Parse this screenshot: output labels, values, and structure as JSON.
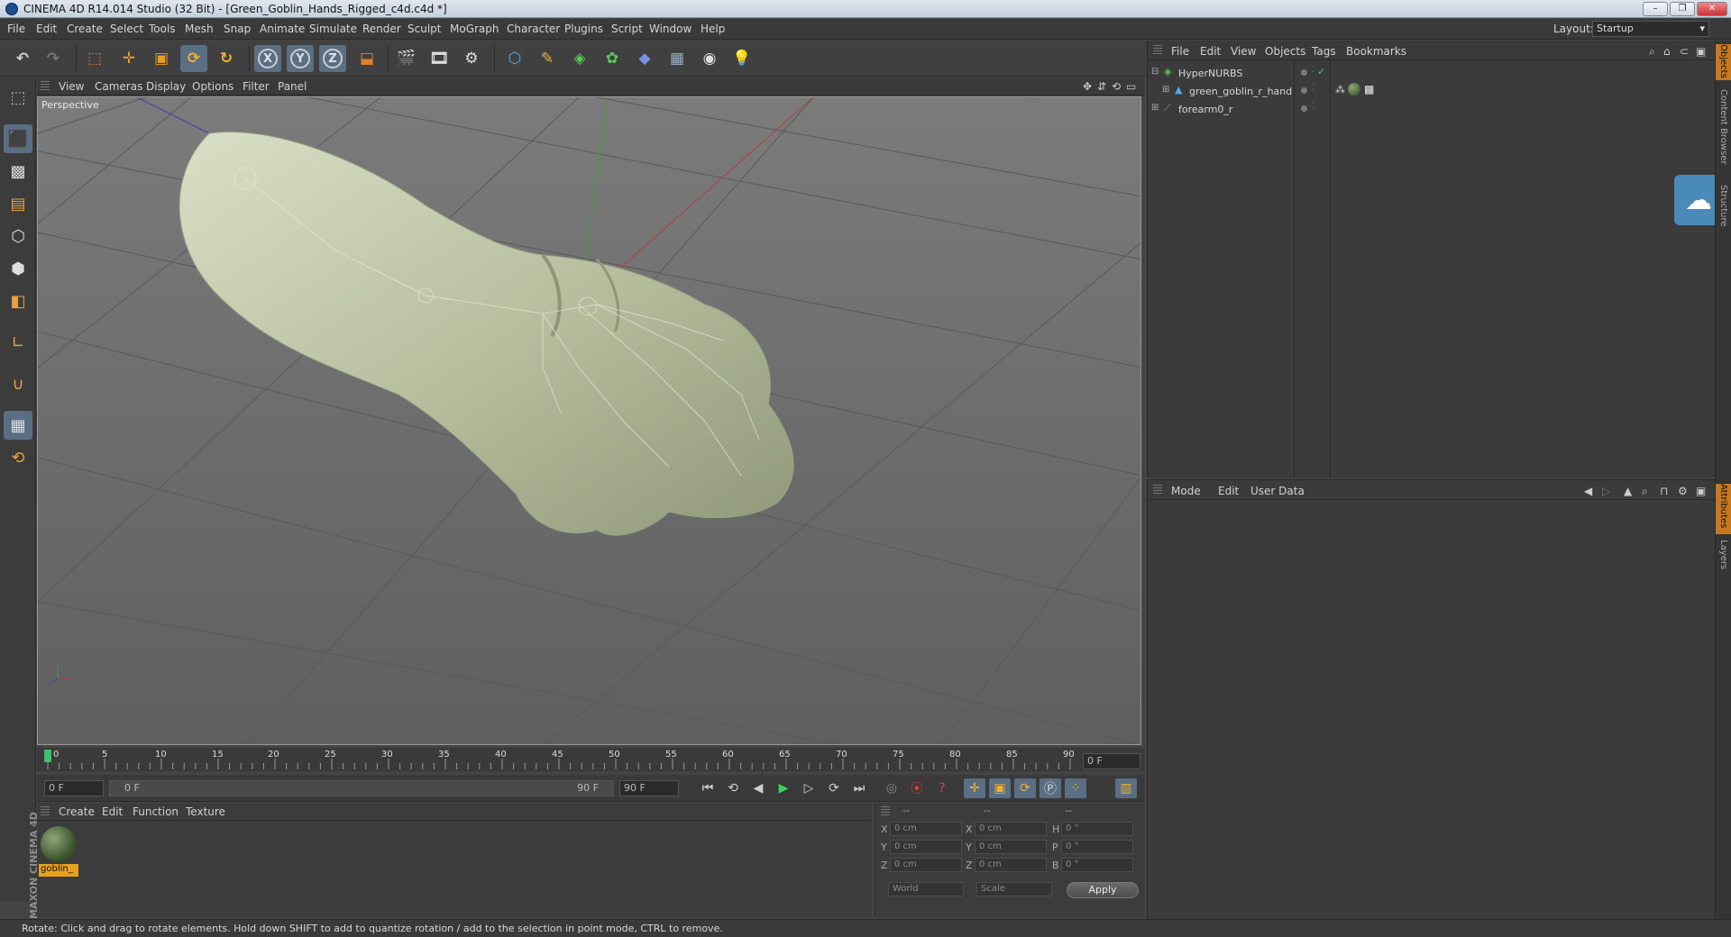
{
  "window": {
    "title": "CINEMA 4D R14.014 Studio (32 Bit) - [Green_Goblin_Hands_Rigged_c4d.c4d *]"
  },
  "menubar": {
    "items": [
      "File",
      "Edit",
      "Create",
      "Select",
      "Tools",
      "Mesh",
      "Snap",
      "Animate",
      "Simulate",
      "Render",
      "Sculpt",
      "MoGraph",
      "Character",
      "Plugins",
      "Script",
      "Window",
      "Help"
    ],
    "layout_label": "Layout:",
    "layout_value": "Startup"
  },
  "toolbar": {
    "icons": [
      "undo-icon",
      "redo-icon",
      "live-selection-icon",
      "move-icon",
      "scale-icon",
      "rotate-icon",
      "recent-tool-icon",
      "x-axis-icon",
      "y-axis-icon",
      "z-axis-icon",
      "coordinate-system-icon",
      "render-view-icon",
      "render-picture-viewer-icon",
      "edit-render-settings-icon",
      "cube-icon",
      "spline-pen-icon",
      "subdivision-surface-icon",
      "array-icon",
      "deformer-icon",
      "floor-icon",
      "camera-icon",
      "light-icon"
    ],
    "axis_labels": [
      "X",
      "Y",
      "Z"
    ]
  },
  "viewport": {
    "menu": [
      "View",
      "Cameras",
      "Display",
      "Options",
      "Filter",
      "Panel"
    ],
    "label": "Perspective",
    "colors": {
      "background": "#6f6f6f",
      "grid": "#5d5d5d",
      "x_axis": "#b04040",
      "y_axis": "#3f9f3f",
      "z_axis": "#4040b0",
      "skin": "#c8cfb3"
    }
  },
  "timeline": {
    "ticks": [
      "0",
      "5",
      "10",
      "15",
      "20",
      "25",
      "30",
      "35",
      "40",
      "45",
      "50",
      "55",
      "60",
      "65",
      "70",
      "75",
      "80",
      "85",
      "90"
    ],
    "current_frame": "0 F",
    "start_field": "0 F",
    "range_start": "0 F",
    "range_end": "90 F",
    "end_field": "90 F"
  },
  "material_manager": {
    "menu": [
      "Create",
      "Edit",
      "Function",
      "Texture"
    ],
    "material_name": "goblin_"
  },
  "coordinates": {
    "headers": [
      "--",
      "--",
      "--"
    ],
    "rows": [
      {
        "label": "X",
        "pos": "0 cm",
        "size_label": "X",
        "size": "0 cm",
        "rot_label": "H",
        "rot": "0 °"
      },
      {
        "label": "Y",
        "pos": "0 cm",
        "size_label": "Y",
        "size": "0 cm",
        "rot_label": "P",
        "rot": "0 °"
      },
      {
        "label": "Z",
        "pos": "0 cm",
        "size_label": "Z",
        "size": "0 cm",
        "rot_label": "B",
        "rot": "0 °"
      }
    ],
    "mode": "World",
    "scale": "Scale",
    "apply": "Apply"
  },
  "object_manager": {
    "menu": [
      "File",
      "Edit",
      "View",
      "Objects",
      "Tags",
      "Bookmarks"
    ],
    "objects": [
      {
        "name": "HyperNURBS"
      },
      {
        "name": "green_goblin_r_hand"
      },
      {
        "name": "forearm0_r"
      }
    ]
  },
  "attribute_manager": {
    "menu": [
      "Mode",
      "Edit",
      "User Data"
    ]
  },
  "side_tabs": [
    "Objects",
    "Content Browser",
    "Structure",
    "Attributes",
    "Layers"
  ],
  "status": {
    "text": "Rotate: Click and drag to rotate elements. Hold down SHIFT to add to quantize rotation / add to the selection in point mode, CTRL to remove."
  }
}
